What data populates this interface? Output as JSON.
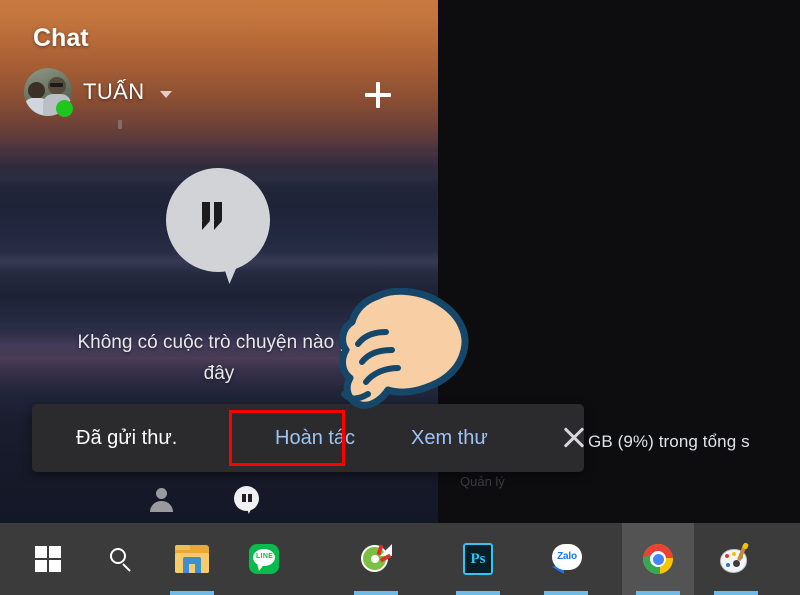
{
  "app": {
    "panel_title": "Chat",
    "account_name": "TUẤN",
    "account_caret_icon": "chevron-down-icon",
    "add_icon": "plus-icon",
    "status": "online"
  },
  "empty_state": {
    "bubble_icon": "hangouts-quote-bubble-icon",
    "line1": "Không có cuộc trò chuyện nào gầ",
    "line2": "đây"
  },
  "bottom_nav": {
    "contacts_icon": "person-icon",
    "conversations_icon": "hangouts-bubble-icon"
  },
  "toast": {
    "message": "Đã gửi thư.",
    "undo_label": "Hoàn tác",
    "view_label": "Xem thư",
    "close_icon": "close-icon"
  },
  "annotation": {
    "highlight_color": "#ff0000",
    "target": "Hoàn tác"
  },
  "cursor": {
    "icon": "pointing-hand-cursor",
    "fill": "#f8cfa4",
    "outline": "#15476b"
  },
  "background_page": {
    "storage_text": "GB (9%) trong tổng s",
    "manage_text": "Quản lý"
  },
  "taskbar": {
    "background": "#3b3b3b",
    "active_highlight": "#535353",
    "indicator_color": "#6fbbe8",
    "items": [
      {
        "name": "start",
        "icon": "windows-logo-icon",
        "running": false,
        "active": false
      },
      {
        "name": "search",
        "icon": "search-icon",
        "running": false,
        "active": false
      },
      {
        "name": "file-explorer",
        "icon": "folder-icon",
        "running": true,
        "active": false
      },
      {
        "name": "line",
        "icon": "line-app-icon",
        "running": false,
        "active": false
      },
      {
        "name": "disc-burner",
        "icon": "disc-icon",
        "running": true,
        "active": false
      },
      {
        "name": "photoshop",
        "icon": "photoshop-icon",
        "running": true,
        "active": false
      },
      {
        "name": "zalo",
        "icon": "zalo-icon",
        "running": true,
        "active": false
      },
      {
        "name": "chrome",
        "icon": "chrome-icon",
        "running": true,
        "active": true
      },
      {
        "name": "paint",
        "icon": "paint-icon",
        "running": true,
        "active": false
      }
    ]
  },
  "colors": {
    "link_blue": "#9ec3f5",
    "toast_bg": "#2b2b2e",
    "status_green": "#1fc61f"
  }
}
